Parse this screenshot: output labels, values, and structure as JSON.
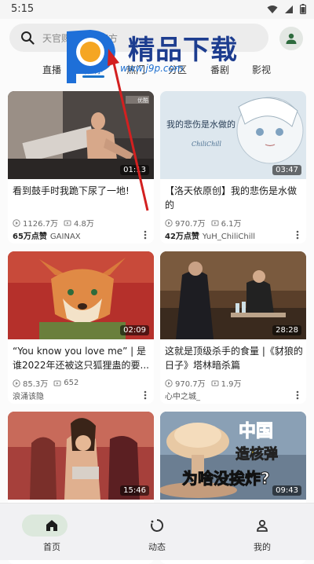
{
  "status": {
    "time": "5:15"
  },
  "search": {
    "placeholder": "天官赐福动画官方"
  },
  "tabs": [
    {
      "label": "直播",
      "active": false
    },
    {
      "label": "推荐",
      "active": true
    },
    {
      "label": "热门",
      "active": false
    },
    {
      "label": "分区",
      "active": false
    },
    {
      "label": "番剧",
      "active": false
    },
    {
      "label": "影视",
      "active": false
    }
  ],
  "cards": [
    {
      "title": "看到鼓手时我跪下尿了一地!",
      "duration": "01:13",
      "views": "1126.7万",
      "likes": "4.8万",
      "badge": "65万点赞",
      "author": "GAINAX",
      "thumb_label": "优酷"
    },
    {
      "title": "【洛天依原创】我的悲伤是水做的",
      "duration": "03:47",
      "views": "970.7万",
      "likes": "6.1万",
      "badge": "42万点赞",
      "author": "YuH_ChiliChill",
      "thumb_text": "我的悲伤是水做的",
      "thumb_sign": "ChiliChill"
    },
    {
      "title": "“You know you love me” | 是谁2022年还被这只狐狸蛊的要...",
      "duration": "02:09",
      "views": "85.3万",
      "likes": "652",
      "badge": "",
      "author": "浪涌该隐"
    },
    {
      "title": "这就是顶级杀手的食量 |《豺狼的日子》塔林暗杀篇",
      "duration": "28:28",
      "views": "970.7万",
      "likes": "1.9万",
      "badge": "",
      "author": "心中之城_"
    },
    {
      "title": "",
      "duration": "15:46"
    },
    {
      "title": "",
      "duration": "09:43",
      "thumb_line1": "中国",
      "thumb_line2": "造核弹",
      "thumb_line3": "为啥没挨炸?"
    }
  ],
  "bottom_nav": [
    {
      "label": "首页",
      "icon": "home-icon",
      "active": true
    },
    {
      "label": "动态",
      "icon": "dynamic-icon",
      "active": false
    },
    {
      "label": "我的",
      "icon": "profile-icon",
      "active": false
    }
  ],
  "watermark": {
    "text": "精品下载",
    "url": "www.j9p.com"
  },
  "colors": {
    "accent": "#1a73c9",
    "nav_active_bg": "#dce8dc",
    "watermark": "#1d3d8f"
  }
}
